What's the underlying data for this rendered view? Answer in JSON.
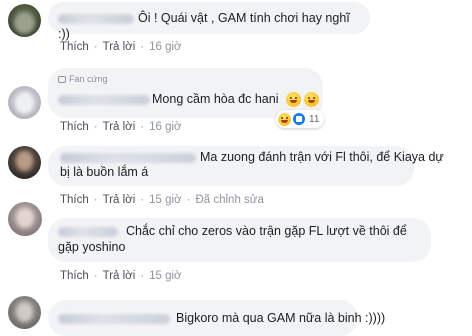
{
  "actions": {
    "like": "Thích",
    "reply": "Trả lời",
    "separator": "·"
  },
  "comments": [
    {
      "text": "Ôi ! Quái vật , GAM tính chơi hay nghĩ :))",
      "time": "16 giờ"
    },
    {
      "badge": "Fan cứng",
      "text": "Mong cầm hòa đc hani",
      "time": "16 giờ",
      "reactions": {
        "count": "11"
      }
    },
    {
      "text_line1": "Ma zuong đánh trận với Fl thôi, để Kiaya dự",
      "text_line2": "bị là buồn lắm á",
      "time": "15 giờ",
      "edited": "Đã chỉnh sửa"
    },
    {
      "text_line1": "Chắc chỉ cho zeros vào trận gặp FL lượt về thôi để",
      "text_line2": "gặp yoshino",
      "time": "15 giờ"
    },
    {
      "text": "Bigkoro mà qua GAM nữa là binh :))))"
    }
  ],
  "colors": {
    "bubble": "#f2f3f5",
    "text": "#1c1e21",
    "meta": "#90949c"
  }
}
